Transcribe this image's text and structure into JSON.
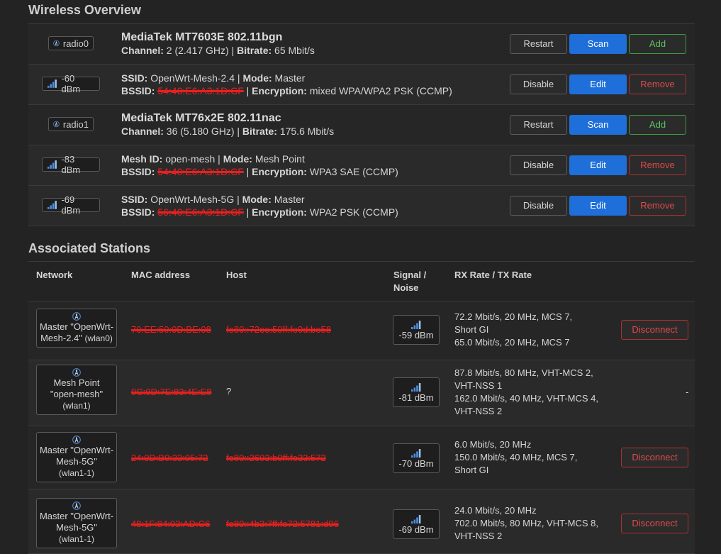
{
  "wireless_overview": {
    "title": "Wireless Overview",
    "devices": [
      {
        "radio": "radio0",
        "name": "MediaTek MT7603E 802.11bgn",
        "channel_label": "Channel:",
        "channel": "2 (2.417 GHz)",
        "bitrate_label": "Bitrate:",
        "bitrate": "65 Mbit/s",
        "buttons": {
          "restart": "Restart",
          "scan": "Scan",
          "add": "Add"
        },
        "networks": [
          {
            "signal": "-60 dBm",
            "id_label": "SSID:",
            "id": "OpenWrt-Mesh-2.4",
            "mode_label": "Mode:",
            "mode": "Master",
            "bssid_label": "BSSID:",
            "bssid": "54:40:E6:A3:1D:CF",
            "enc_label": "Encryption:",
            "encryption": "mixed WPA/WPA2 PSK (CCMP)",
            "buttons": {
              "disable": "Disable",
              "edit": "Edit",
              "remove": "Remove"
            }
          }
        ]
      },
      {
        "radio": "radio1",
        "name": "MediaTek MT76x2E 802.11nac",
        "channel_label": "Channel:",
        "channel": "36 (5.180 GHz)",
        "bitrate_label": "Bitrate:",
        "bitrate": "175.6 Mbit/s",
        "buttons": {
          "restart": "Restart",
          "scan": "Scan",
          "add": "Add"
        },
        "networks": [
          {
            "signal": "-83 dBm",
            "id_label": "Mesh ID:",
            "id": "open-mesh",
            "mode_label": "Mode:",
            "mode": "Mesh Point",
            "bssid_label": "BSSID:",
            "bssid": "54:40:E6:A3:1D:CF",
            "enc_label": "Encryption:",
            "encryption": "WPA3 SAE (CCMP)",
            "buttons": {
              "disable": "Disable",
              "edit": "Edit",
              "remove": "Remove"
            }
          },
          {
            "signal": "-69 dBm",
            "id_label": "SSID:",
            "id": "OpenWrt-Mesh-5G",
            "mode_label": "Mode:",
            "mode": "Master",
            "bssid_label": "BSSID:",
            "bssid": "56:40:E6:A3:1D:CF",
            "enc_label": "Encryption:",
            "encryption": "WPA2 PSK (CCMP)",
            "buttons": {
              "disable": "Disable",
              "edit": "Edit",
              "remove": "Remove"
            }
          }
        ]
      }
    ]
  },
  "associated_stations": {
    "title": "Associated Stations",
    "headers": {
      "network": "Network",
      "mac": "MAC address",
      "host": "Host",
      "signal_1": "Signal /",
      "signal_2": "Noise",
      "rate": "RX Rate / TX Rate"
    },
    "rows": [
      {
        "net_line1": "Master \"OpenWrt-",
        "net_line2": "Mesh-2.4\"",
        "iface": "(wlan0)",
        "mac": "70:EE:50:0D:BE:08",
        "host": "fe80::72ee:50ff:fe0d:be58",
        "signal": "-59 dBm",
        "rx_1": "72.2 Mbit/s, 20 MHz, MCS 7,",
        "rx_2": "Short GI",
        "tx_1": "65.0 Mbit/s, 20 MHz, MCS 7",
        "tx_2": "",
        "action": "Disconnect"
      },
      {
        "net_line1": "Mesh Point",
        "net_line2": "\"open-mesh\"",
        "iface": "(wlan1)",
        "mac": "0C:0D:7E:83:4E:E8",
        "host": "?",
        "signal": "-81 dBm",
        "rx_1": "87.8 Mbit/s, 80 MHz, VHT-MCS 2,",
        "rx_2": "VHT-NSS 1",
        "tx_1": "162.0 Mbit/s, 40 MHz, VHT-MCS 4,",
        "tx_2": "VHT-NSS 2",
        "action": "-"
      },
      {
        "net_line1": "Master \"OpenWrt-",
        "net_line2": "Mesh-5G\"",
        "iface": "(wlan1-1)",
        "mac": "24:0D:B0:33:05:72",
        "host": "fe80::2603:b0ff:fe33:572",
        "signal": "-70 dBm",
        "rx_1": "6.0 Mbit/s, 20 MHz",
        "rx_2": "",
        "tx_1": "150.0 Mbit/s, 40 MHz, MCS 7,",
        "tx_2": "Short GI",
        "action": "Disconnect"
      },
      {
        "net_line1": "Master \"OpenWrt-",
        "net_line2": "Mesh-5G\"",
        "iface": "(wlan1-1)",
        "mac": "48:1F:84:03:AD:C6",
        "host": "fe80::4b3:7ff:fe72:5781:d06",
        "signal": "-69 dBm",
        "rx_1": "24.0 Mbit/s, 20 MHz",
        "rx_2": "",
        "tx_1": "702.0 Mbit/s, 80 MHz, VHT-MCS 8,",
        "tx_2": "VHT-NSS 2",
        "action": "Disconnect"
      }
    ]
  },
  "colors": {
    "background": "#232323",
    "primary_button": "#1e6fd9",
    "positive_button": "#3e9b3e",
    "negative_button": "#b03030",
    "redaction_mark": "#e82020",
    "signal_bars": "#4a8fe0"
  },
  "icons": {
    "radio": "antenna-icon",
    "signal": "signal-bars-icon"
  }
}
